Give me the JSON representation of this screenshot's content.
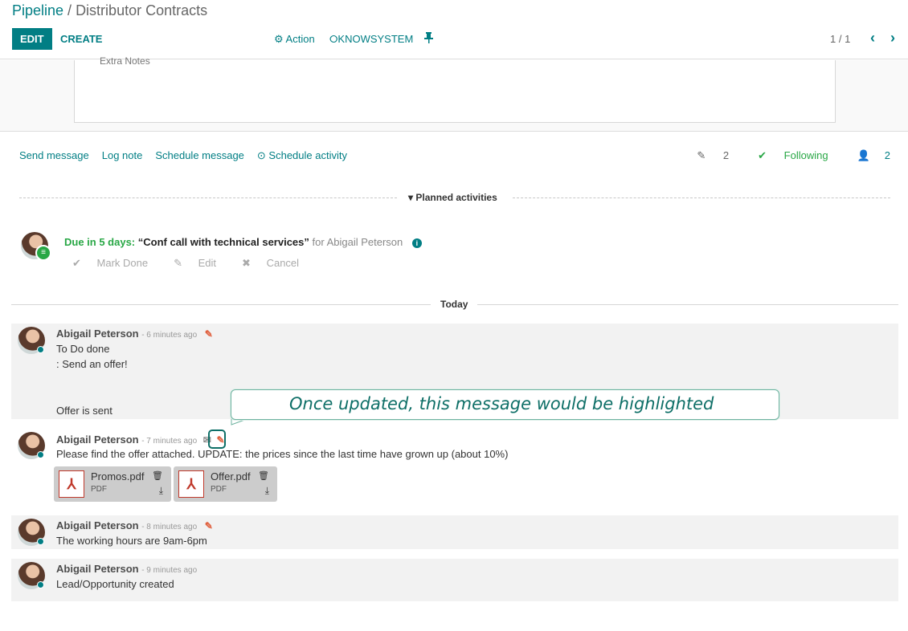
{
  "header": {
    "breadcrumb_root": "Pipeline",
    "breadcrumb_sep": " / ",
    "breadcrumb_current": "Distributor Contracts",
    "edit_label": "EDIT",
    "create_label": "CREATE",
    "action_label": "⚙ Action",
    "knowsystem_label": "⭘KNOWSYSTEM",
    "pager": "1 / 1"
  },
  "form": {
    "extra_notes_label": "Extra Notes"
  },
  "chatter": {
    "send_message": "Send message",
    "log_note": "Log note",
    "schedule_message": "Schedule message",
    "schedule_activity": "⊙ Schedule activity",
    "attachments_count": "2",
    "following_label": "Following",
    "followers_count": "2"
  },
  "planned": {
    "header": "Planned activities",
    "due": "Due in 5 days:",
    "title": "“Conf call with technical services”",
    "for": "for Abigail Peterson",
    "mark_done": "Mark Done",
    "edit": "Edit",
    "cancel": "Cancel"
  },
  "today_label": "Today",
  "messages": [
    {
      "author": "Abigail Peterson",
      "ago": "- 6 minutes ago",
      "lines": [
        "To Do done",
        ": Send an offer!",
        "Offer is sent"
      ]
    },
    {
      "author": "Abigail Peterson",
      "ago": "- 7 minutes ago",
      "lines": [
        "Please find the offer attached. UPDATE: the prices since the last time have grown up (about 10%)"
      ],
      "attachments": [
        {
          "name": "Promos.pdf",
          "type": "PDF"
        },
        {
          "name": "Offer.pdf",
          "type": "PDF"
        }
      ]
    },
    {
      "author": "Abigail Peterson",
      "ago": "- 8 minutes ago",
      "lines": [
        "The working hours are 9am-6pm"
      ]
    },
    {
      "author": "Abigail Peterson",
      "ago": "- 9 minutes ago",
      "lines": [
        "Lead/Opportunity created"
      ]
    }
  ],
  "callout": {
    "text": "Once updated, this message would be highlighted"
  },
  "colors": {
    "primary": "#017e84",
    "success": "#28a745",
    "edit_icon": "#e0603e",
    "callout_border": "#6fb3a0"
  },
  "icons": {
    "pin": "pin-icon",
    "paperclip": "paperclip-icon",
    "check": "check-icon",
    "user": "user-icon",
    "info": "info-icon",
    "edit": "edit-icon",
    "envelope": "envelope-icon",
    "pdf": "pdf-icon",
    "trash": "trash-icon",
    "download": "download-icon"
  }
}
